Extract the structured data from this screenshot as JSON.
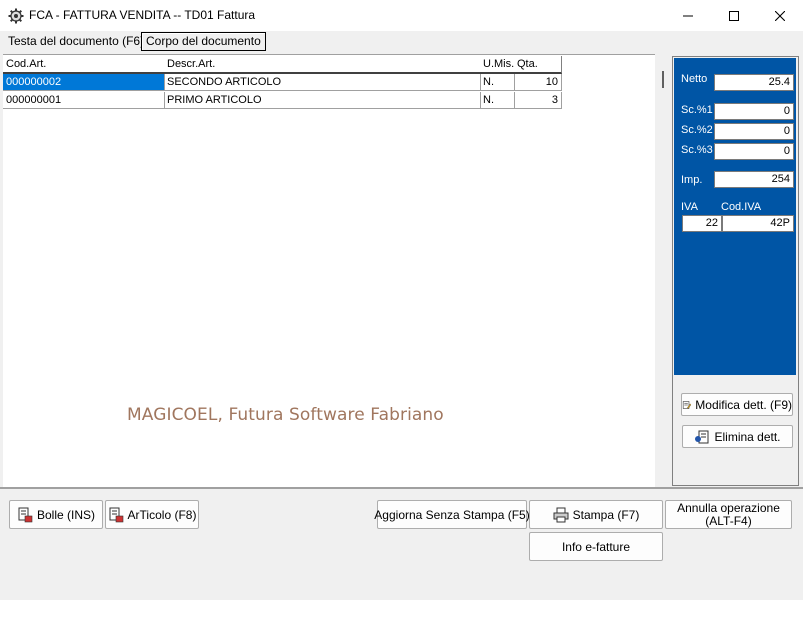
{
  "window": {
    "title": "FCA - FATTURA VENDITA  --  TD01 Fattura",
    "controls": [
      "minimize",
      "maximize",
      "close"
    ]
  },
  "tabs": [
    {
      "label": "Testa del documento (F6)",
      "active": false
    },
    {
      "label": "Corpo del documento",
      "active": true
    }
  ],
  "grid": {
    "columns": [
      "Cod.Art.",
      "Descr.Art.",
      "U.Mis.",
      "Qta."
    ],
    "rows": [
      {
        "cod": "000000002",
        "descr": "SECONDO ARTICOLO",
        "umis": "N.",
        "qta": "10",
        "selected": true
      },
      {
        "cod": "000000001",
        "descr": "PRIMO ARTICOLO",
        "umis": "N.",
        "qta": "3",
        "selected": false
      }
    ]
  },
  "watermark": "MAGICOEL, Futura Software Fabriano",
  "side_panel": {
    "netto_label": "Netto",
    "netto_value": "25.4",
    "sc1_label": "Sc.%1",
    "sc1_value": "0",
    "sc2_label": "Sc.%2",
    "sc2_value": "0",
    "sc3_label": "Sc.%3",
    "sc3_value": "0",
    "imp_label": "Imp.",
    "imp_value": "254",
    "iva_label": "IVA",
    "iva_value": "22",
    "codiva_label": "Cod.IVA",
    "codiva_value": "42P",
    "modifica_label": "Modifica dett. (F9)",
    "elimina_label": "Elimina dett."
  },
  "bottom_buttons": {
    "bolle": "Bolle  (INS)",
    "articolo": "ArTicolo (F8)",
    "aggiorna": "Aggiorna Senza Stampa (F5)",
    "stampa": "Stampa  (F7)",
    "annulla_line1": "Annulla operazione",
    "annulla_line2": "(ALT-F4)",
    "info": "Info e-fatture"
  },
  "colors": {
    "selection": "#0078d7",
    "panel_blue": "#0055a5",
    "watermark": "#a0765e"
  }
}
